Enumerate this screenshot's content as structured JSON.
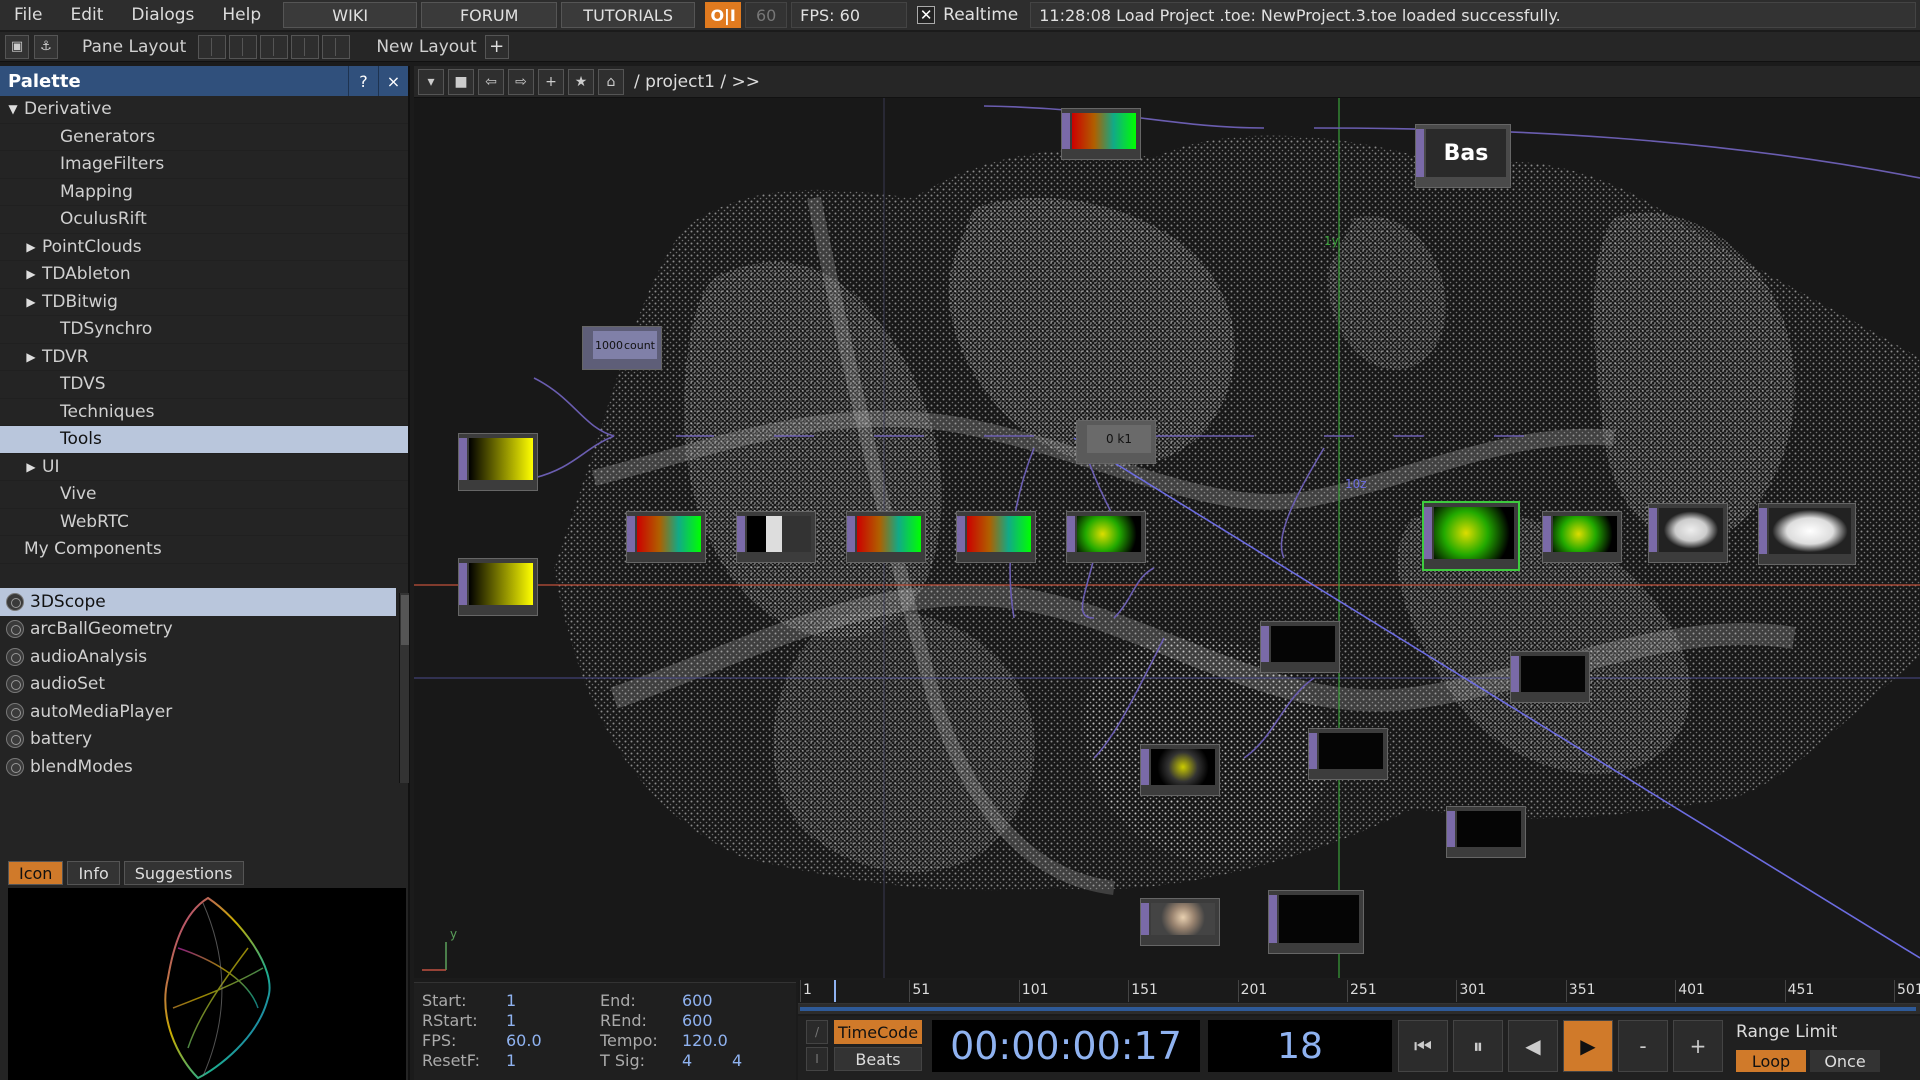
{
  "menubar": {
    "items": [
      "File",
      "Edit",
      "Dialogs",
      "Help"
    ],
    "wiki": "WIKI",
    "forum": "FORUM",
    "tutorials": "TUTORIALS",
    "perf_toggle": "O|I",
    "fps_target": "60",
    "fps_readout": "FPS:  60",
    "realtime_check": "✕",
    "realtime_label": "Realtime",
    "status_message": "11:28:08 Load Project .toe: NewProject.3.toe loaded successfully."
  },
  "toolbar2": {
    "pane_layout_label": "Pane Layout",
    "new_layout_label": "New Layout",
    "add_layout": "+"
  },
  "palette": {
    "title": "Palette",
    "help": "?",
    "close": "×",
    "tree": [
      {
        "label": "Derivative",
        "arrow": "▼",
        "indent": 0
      },
      {
        "label": "Generators",
        "arrow": "",
        "indent": 2
      },
      {
        "label": "ImageFilters",
        "arrow": "",
        "indent": 2
      },
      {
        "label": "Mapping",
        "arrow": "",
        "indent": 2
      },
      {
        "label": "OculusRift",
        "arrow": "",
        "indent": 2
      },
      {
        "label": "PointClouds",
        "arrow": "▶",
        "indent": 1
      },
      {
        "label": "TDAbleton",
        "arrow": "▶",
        "indent": 1
      },
      {
        "label": "TDBitwig",
        "arrow": "▶",
        "indent": 1
      },
      {
        "label": "TDSynchro",
        "arrow": "",
        "indent": 2
      },
      {
        "label": "TDVR",
        "arrow": "▶",
        "indent": 1
      },
      {
        "label": "TDVS",
        "arrow": "",
        "indent": 2
      },
      {
        "label": "Techniques",
        "arrow": "",
        "indent": 2
      },
      {
        "label": "Tools",
        "arrow": "",
        "indent": 2,
        "selected": true
      },
      {
        "label": "UI",
        "arrow": "▶",
        "indent": 1
      },
      {
        "label": "Vive",
        "arrow": "",
        "indent": 2
      },
      {
        "label": "WebRTC",
        "arrow": "",
        "indent": 2
      },
      {
        "label": "My Components",
        "arrow": "",
        "indent": 0
      }
    ],
    "components": [
      "3DScope",
      "arcBallGeometry",
      "audioAnalysis",
      "audioSet",
      "autoMediaPlayer",
      "battery",
      "blendModes"
    ],
    "selected_component": "3DScope",
    "tabs": [
      "Icon",
      "Info",
      "Suggestions"
    ],
    "active_tab": "Icon"
  },
  "network": {
    "breadcrumb": "/ project1 / >>",
    "node_labels": {
      "count_value": "1000",
      "count_name": "count",
      "constant_value": "0 k1",
      "text_top": "Bas",
      "axis_y": "1y",
      "axis_z": "10z",
      "origin_y": "y"
    }
  },
  "timeline": {
    "start_label": "Start:",
    "start": "1",
    "end_label": "End:",
    "end": "600",
    "rstart_label": "RStart:",
    "rstart": "1",
    "rend_label": "REnd:",
    "rend": "600",
    "fps_label": "FPS:",
    "fps": "60.0",
    "tempo_label": "Tempo:",
    "tempo": "120.0",
    "resetf_label": "ResetF:",
    "resetf": "1",
    "tsig_label": "T Sig:",
    "tsig_num": "4",
    "tsig_den": "4",
    "ruler": [
      "1",
      "51",
      "101",
      "151",
      "201",
      "251",
      "301",
      "351",
      "401",
      "451",
      "501"
    ],
    "timecode_btn": "TimeCode",
    "beats_btn": "Beats",
    "timecode": "00:00:00:17",
    "frame": "18",
    "range_limit_label": "Range Limit",
    "loop": "Loop",
    "once": "Once",
    "minus": "-",
    "plus": "+"
  },
  "colors": {
    "accent_orange": "#d07a2a",
    "palette_header": "#30507c",
    "selection": "#b9c6dc",
    "timecode_text": "#8fb2f0",
    "node_selected": "#3ecb3e"
  }
}
